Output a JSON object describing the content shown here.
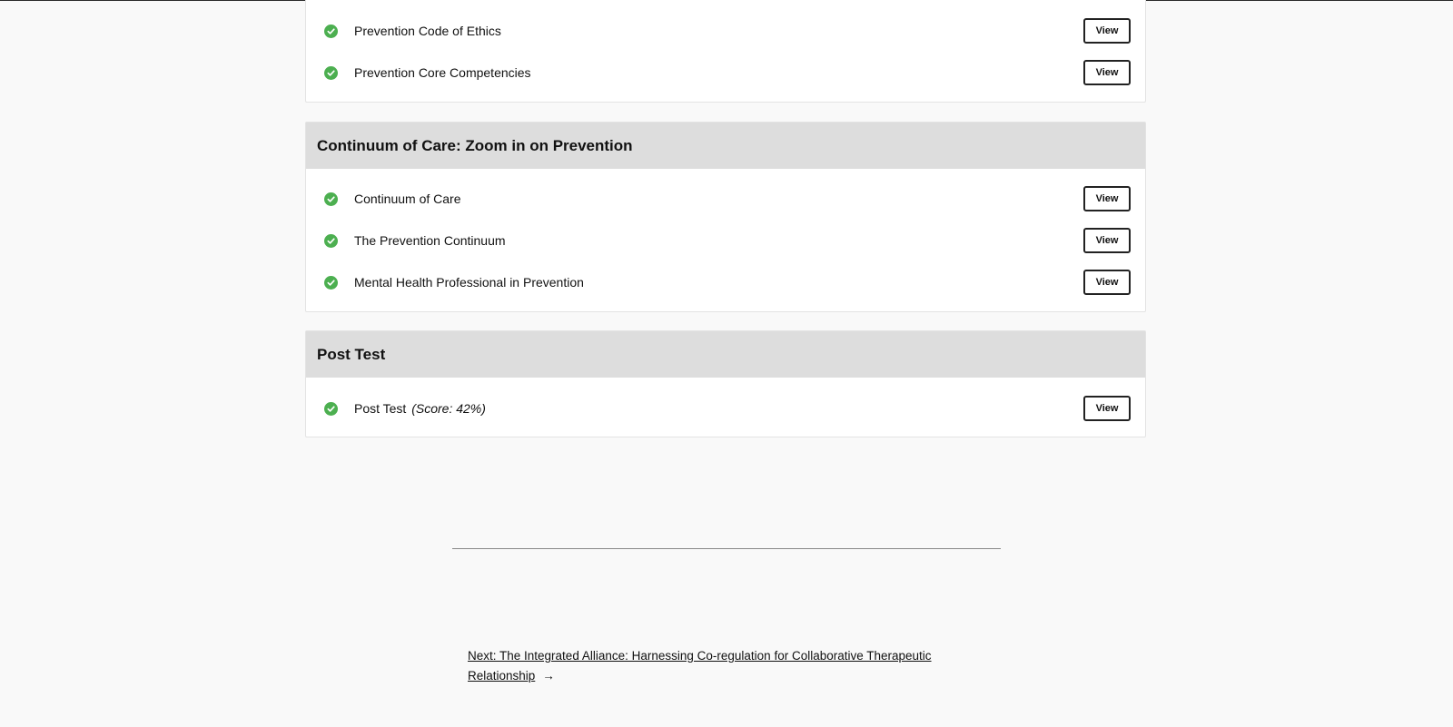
{
  "sections": [
    {
      "header": "",
      "lessons": [
        {
          "title": "Prevention Code of Ethics",
          "action": "View"
        },
        {
          "title": "Prevention Core Competencies",
          "action": "View"
        }
      ]
    },
    {
      "header": "Continuum of Care: Zoom in on Prevention",
      "lessons": [
        {
          "title": "Continuum of Care",
          "action": "View"
        },
        {
          "title": "The Prevention Continuum",
          "action": "View"
        },
        {
          "title": "Mental Health Professional in Prevention",
          "action": "View"
        }
      ]
    },
    {
      "header": "Post Test",
      "lessons": [
        {
          "title": "Post Test",
          "score": "(Score: 42%)",
          "action": "View"
        }
      ]
    }
  ],
  "navigation": {
    "next_label": "Next: The Integrated Alliance: Harnessing Co-regulation for Collaborative Therapeutic Relationship",
    "arrow": "→"
  },
  "colors": {
    "check": "#4caf50",
    "header_bg": "#dddddd",
    "page_bg": "#f9f9f9"
  }
}
